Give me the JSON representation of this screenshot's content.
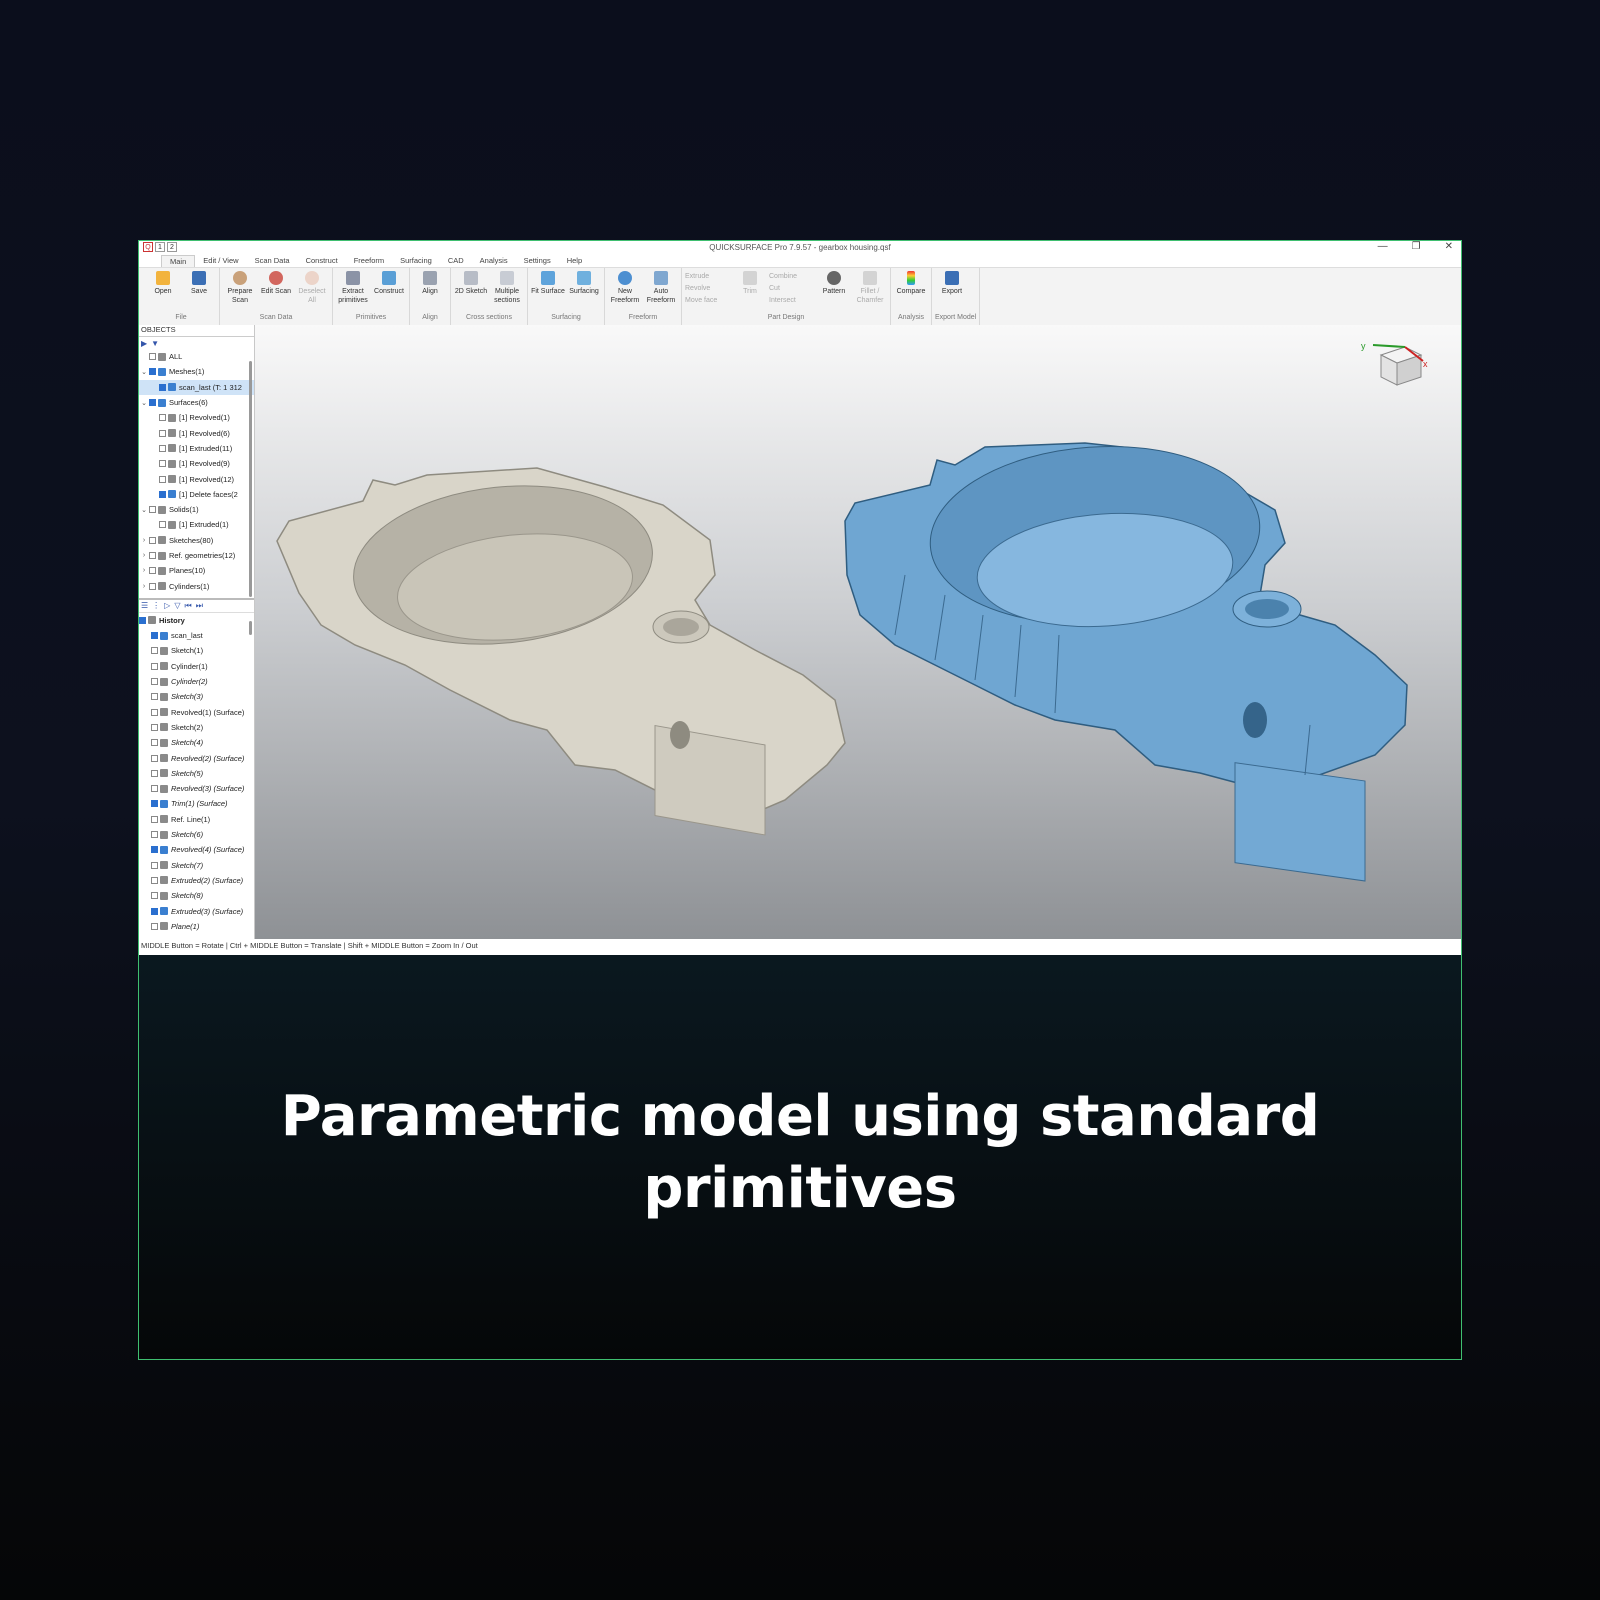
{
  "app": {
    "title": "QUICKSURFACE Pro 7.9.57 - gearbox housing.qsf",
    "quick_access": [
      "1",
      "2"
    ],
    "window_controls": [
      "—",
      "❐",
      "✕"
    ]
  },
  "menu": [
    "Main",
    "Edit / View",
    "Scan Data",
    "Construct",
    "Freeform",
    "Surfacing",
    "CAD",
    "Analysis",
    "Settings",
    "Help"
  ],
  "ribbon": {
    "file": {
      "label": "File",
      "open": "Open",
      "save": "Save"
    },
    "scan_data": {
      "label": "Scan Data",
      "prepare": "Prepare Scan",
      "edit": "Edit Scan",
      "deselect": "Deselect All"
    },
    "primitives": {
      "label": "Primitives",
      "extract": "Extract primitives",
      "construct": "Construct"
    },
    "align": {
      "label": "Align",
      "align": "Align"
    },
    "cross_sections": {
      "label": "Cross sections",
      "sketch2d": "2D Sketch",
      "multiple": "Multiple sections"
    },
    "surfacing": {
      "label": "Surfacing",
      "fit": "Fit Surface",
      "surfacing": "Surfacing"
    },
    "freeform": {
      "label": "Freeform",
      "new": "New Freeform",
      "auto": "Auto Freeform"
    },
    "part_design": {
      "label": "Part Design",
      "extrude": "Extrude",
      "revolve": "Revolve",
      "move_face": "Move face",
      "trim": "Trim",
      "combine": "Combine",
      "cut": "Cut",
      "intersect": "Intersect",
      "pattern": "Pattern",
      "fillet": "Fillet / Chamfer"
    },
    "analysis": {
      "label": "Analysis",
      "compare": "Compare"
    },
    "export": {
      "label": "Export Model",
      "export": "Export"
    }
  },
  "objects": {
    "header": "OBJECTS",
    "items": [
      {
        "label": "ALL",
        "level": 0,
        "arrow": "",
        "checked": false
      },
      {
        "label": "Meshes(1)",
        "level": 0,
        "arrow": "⌄",
        "checked": true
      },
      {
        "label": "scan_last (T: 1 312",
        "level": 1,
        "arrow": "",
        "checked": true,
        "selected": true
      },
      {
        "label": "Surfaces(6)",
        "level": 0,
        "arrow": "⌄",
        "checked": true
      },
      {
        "label": "[1] Revolved(1)",
        "level": 1,
        "arrow": "",
        "checked": false
      },
      {
        "label": "[1] Revolved(6)",
        "level": 1,
        "arrow": "",
        "checked": false
      },
      {
        "label": "[1] Extruded(11)",
        "level": 1,
        "arrow": "",
        "checked": false
      },
      {
        "label": "[1] Revolved(9)",
        "level": 1,
        "arrow": "",
        "checked": false
      },
      {
        "label": "[1] Revolved(12)",
        "level": 1,
        "arrow": "",
        "checked": false
      },
      {
        "label": "[1] Delete faces(2",
        "level": 1,
        "arrow": "",
        "checked": true
      },
      {
        "label": "Solids(1)",
        "level": 0,
        "arrow": "⌄",
        "checked": false
      },
      {
        "label": "[1] Extruded(1)",
        "level": 1,
        "arrow": "",
        "checked": false
      },
      {
        "label": "Sketches(80)",
        "level": 0,
        "arrow": "›",
        "checked": false
      },
      {
        "label": "Ref. geometries(12)",
        "level": 0,
        "arrow": "›",
        "checked": false
      },
      {
        "label": "Planes(10)",
        "level": 0,
        "arrow": "›",
        "checked": false
      },
      {
        "label": "Cylinders(1)",
        "level": 0,
        "arrow": "›",
        "checked": false
      }
    ]
  },
  "history": {
    "header": "History",
    "items": [
      {
        "label": "scan_last",
        "checked": true,
        "italic": false
      },
      {
        "label": "Sketch(1)",
        "checked": false,
        "italic": false
      },
      {
        "label": "Cylinder(1)",
        "checked": false,
        "italic": false
      },
      {
        "label": "Cylinder(2)",
        "checked": false,
        "italic": true
      },
      {
        "label": "Sketch(3)",
        "checked": false,
        "italic": true
      },
      {
        "label": "Revolved(1) (Surface)",
        "checked": false,
        "italic": false
      },
      {
        "label": "Sketch(2)",
        "checked": false,
        "italic": false
      },
      {
        "label": "Sketch(4)",
        "checked": false,
        "italic": true
      },
      {
        "label": "Revolved(2) (Surface)",
        "checked": false,
        "italic": true
      },
      {
        "label": "Sketch(5)",
        "checked": false,
        "italic": true
      },
      {
        "label": "Revolved(3) (Surface)",
        "checked": false,
        "italic": true
      },
      {
        "label": "Trim(1) (Surface)",
        "checked": true,
        "italic": true
      },
      {
        "label": "Ref. Line(1)",
        "checked": false,
        "italic": false
      },
      {
        "label": "Sketch(6)",
        "checked": false,
        "italic": true
      },
      {
        "label": "Revolved(4) (Surface)",
        "checked": true,
        "italic": true
      },
      {
        "label": "Sketch(7)",
        "checked": false,
        "italic": true
      },
      {
        "label": "Extruded(2) (Surface)",
        "checked": false,
        "italic": true
      },
      {
        "label": "Sketch(8)",
        "checked": false,
        "italic": true
      },
      {
        "label": "Extruded(3) (Surface)",
        "checked": true,
        "italic": true
      },
      {
        "label": "Plane(1)",
        "checked": false,
        "italic": true
      }
    ]
  },
  "viewport": {
    "axis_y": "y",
    "axis_x": "x",
    "mesh_color": "#d8d4c8",
    "cad_color": "#6fa6d2"
  },
  "status": "MIDDLE Button = Rotate | Ctrl + MIDDLE Button = Translate | Shift + MIDDLE Button = Zoom In / Out",
  "caption": {
    "line1": "Parametric model using standard",
    "line2": "primitives"
  }
}
